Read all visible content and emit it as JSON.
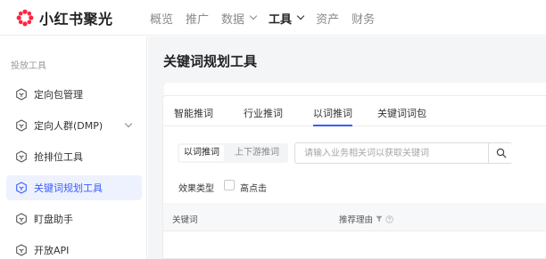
{
  "brand": {
    "name": "小红书聚光"
  },
  "nav": {
    "items": [
      {
        "label": "概览",
        "active": false
      },
      {
        "label": "推广",
        "active": false
      },
      {
        "label": "数据",
        "active": false,
        "dropdown": true
      },
      {
        "label": "工具",
        "active": true,
        "dropdown": true
      },
      {
        "label": "资产",
        "active": false
      },
      {
        "label": "财务",
        "active": false
      }
    ]
  },
  "sidebar": {
    "heading": "投放工具",
    "items": [
      {
        "label": "定向包管理",
        "icon": "shield-icon",
        "active": false
      },
      {
        "label": "定向人群(DMP)",
        "icon": "shield-icon",
        "active": false,
        "expandable": true
      },
      {
        "label": "抢排位工具",
        "icon": "shield-icon",
        "active": false
      },
      {
        "label": "关键词规划工具",
        "icon": "shield-icon",
        "active": true
      },
      {
        "label": "盯盘助手",
        "icon": "shield-icon",
        "active": false
      },
      {
        "label": "开放API",
        "icon": "shield-icon",
        "active": false
      }
    ]
  },
  "main": {
    "title": "关键词规划工具",
    "tabs": [
      {
        "label": "智能推词",
        "active": false
      },
      {
        "label": "行业推词",
        "active": false
      },
      {
        "label": "以词推词",
        "active": true
      },
      {
        "label": "关键词词包",
        "active": false
      }
    ],
    "segment": {
      "options": [
        "以词推词",
        "上下游推词"
      ],
      "selected": "以词推词"
    },
    "search": {
      "placeholder": "请输入业务相关词以获取关键词",
      "value": ""
    },
    "filter": {
      "label": "效果类型",
      "option": "高点击",
      "checked": false
    },
    "table": {
      "columns": [
        "关键词",
        "推荐理由"
      ]
    }
  },
  "colors": {
    "accent": "#3a5cff",
    "logo": "#ff2442",
    "active_bg": "#eef2ff"
  }
}
